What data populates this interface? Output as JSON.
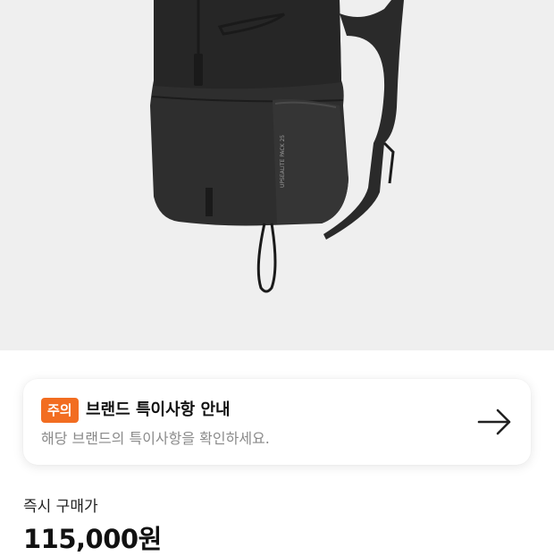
{
  "product": {
    "image_label": "UPSEALITE PACK 25"
  },
  "notice": {
    "badge": "주의",
    "title": "브랜드 특이사항 안내",
    "description": "해당 브랜드의 특이사항을 확인하세요.",
    "arrow_icon": "arrow-right-icon",
    "badge_color": "#f26d21"
  },
  "price": {
    "label": "즉시 구매가",
    "value": "115,000원"
  }
}
